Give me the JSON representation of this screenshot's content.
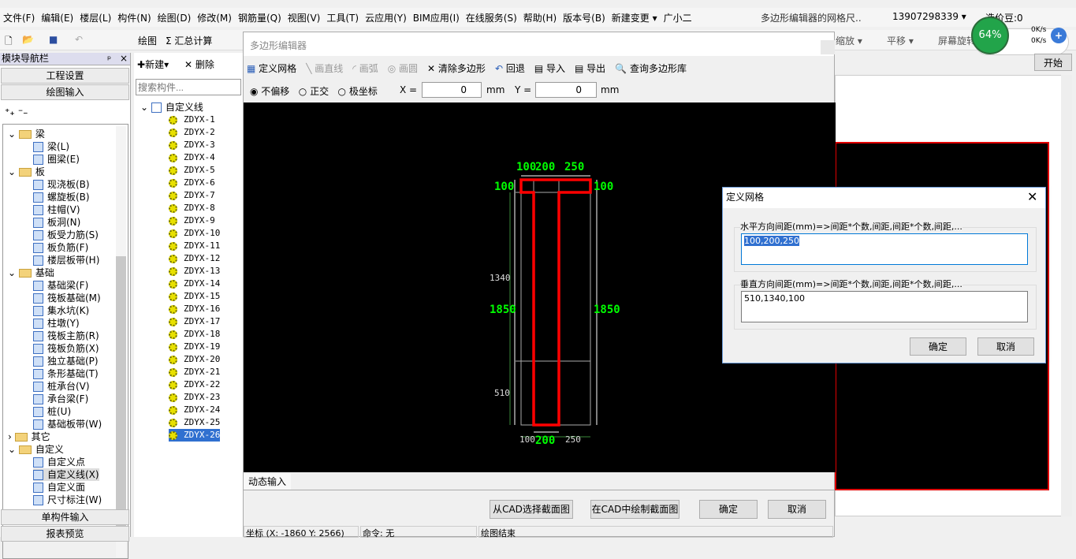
{
  "menu": [
    "文件(F)",
    "编辑(E)",
    "楼层(L)",
    "构件(N)",
    "绘图(D)",
    "修改(M)",
    "钢筋量(Q)",
    "视图(V)",
    "工具(T)",
    "云应用(Y)",
    "BIM应用(I)",
    "在线服务(S)",
    "帮助(H)",
    "版本号(B)",
    "新建变更 ▾",
    "广小二"
  ],
  "notice": "多边形编辑器的网格尺..",
  "account": "13907298339 ▾",
  "beans": "造价豆:0",
  "toolbar": {
    "draw": "绘图",
    "sum": "汇总计算",
    "zoom": "缩放 ▾",
    "pan": "平移 ▾",
    "rotate": "屏幕旋转"
  },
  "net_widget": {
    "percent": "64%",
    "up": "0K/s",
    "down": "0K/s",
    "start": "开始"
  },
  "nav": {
    "title": "模块导航栏",
    "pin": "ᵖ",
    "close": "x",
    "project_settings": "工程设置",
    "draw_input": "绘图输入",
    "single_input": "单构件输入",
    "report": "报表预览",
    "tree": [
      {
        "label": "梁",
        "level": 0,
        "type": "folder"
      },
      {
        "label": "梁(L)",
        "level": 1
      },
      {
        "label": "圈梁(E)",
        "level": 1
      },
      {
        "label": "板",
        "level": 0,
        "type": "folder"
      },
      {
        "label": "现浇板(B)",
        "level": 1
      },
      {
        "label": "螺旋板(B)",
        "level": 1
      },
      {
        "label": "柱帽(V)",
        "level": 1
      },
      {
        "label": "板洞(N)",
        "level": 1
      },
      {
        "label": "板受力筋(S)",
        "level": 1
      },
      {
        "label": "板负筋(F)",
        "level": 1
      },
      {
        "label": "楼层板带(H)",
        "level": 1
      },
      {
        "label": "基础",
        "level": 0,
        "type": "folder"
      },
      {
        "label": "基础梁(F)",
        "level": 1
      },
      {
        "label": "筏板基础(M)",
        "level": 1
      },
      {
        "label": "集水坑(K)",
        "level": 1
      },
      {
        "label": "柱墩(Y)",
        "level": 1
      },
      {
        "label": "筏板主筋(R)",
        "level": 1
      },
      {
        "label": "筏板负筋(X)",
        "level": 1
      },
      {
        "label": "独立基础(P)",
        "level": 1
      },
      {
        "label": "条形基础(T)",
        "level": 1
      },
      {
        "label": "桩承台(V)",
        "level": 1
      },
      {
        "label": "承台梁(F)",
        "level": 1
      },
      {
        "label": "桩(U)",
        "level": 1
      },
      {
        "label": "基础板带(W)",
        "level": 1
      },
      {
        "label": "其它",
        "level": 0,
        "type": "folder",
        "collapsed": true
      },
      {
        "label": "自定义",
        "level": 0,
        "type": "folder"
      },
      {
        "label": "自定义点",
        "level": 1
      },
      {
        "label": "自定义线(X)",
        "level": 1,
        "selected": true
      },
      {
        "label": "自定义面",
        "level": 1
      },
      {
        "label": "尺寸标注(W)",
        "level": 1
      }
    ]
  },
  "components": {
    "new": "新建",
    "delete": "删除",
    "search_placeholder": "搜索构件...",
    "root": "自定义线",
    "items": [
      "ZDYX-1",
      "ZDYX-2",
      "ZDYX-3",
      "ZDYX-4",
      "ZDYX-5",
      "ZDYX-6",
      "ZDYX-7",
      "ZDYX-8",
      "ZDYX-9",
      "ZDYX-10",
      "ZDYX-11",
      "ZDYX-12",
      "ZDYX-13",
      "ZDYX-14",
      "ZDYX-15",
      "ZDYX-16",
      "ZDYX-17",
      "ZDYX-18",
      "ZDYX-19",
      "ZDYX-20",
      "ZDYX-21",
      "ZDYX-22",
      "ZDYX-23",
      "ZDYX-24",
      "ZDYX-25",
      "ZDYX-26"
    ],
    "selected": "ZDYX-26"
  },
  "editor": {
    "title": "多边形编辑器",
    "tools": {
      "grid": "定义网格",
      "line": "画直线",
      "arc": "画弧",
      "circle": "画圆",
      "clear": "清除多边形",
      "undo": "回退",
      "import": "导入",
      "export": "导出",
      "query": "查询多边形库"
    },
    "modes": {
      "none": "不偏移",
      "ortho": "正交",
      "polar": "极坐标",
      "selected": "不偏移"
    },
    "x_label": "X =",
    "x_value": "0",
    "y_label": "Y =",
    "y_value": "0",
    "unit": "mm",
    "dims": {
      "top": [
        "100",
        "200",
        "250"
      ],
      "bottom": [
        "100",
        "200",
        "250"
      ],
      "left_total": "1850",
      "right_total": "1850",
      "left_top": "100",
      "left_top2": "100",
      "right_top": "100",
      "left_mid": "1340",
      "left_bot": "510"
    },
    "dynamic_tab": "动态输入",
    "btn_from_cad": "从CAD选择截面图",
    "btn_draw_cad": "在CAD中绘制截面图",
    "ok": "确定",
    "cancel": "取消",
    "status": {
      "coord": "坐标 (X: -1860 Y: 2566)",
      "command": "命令: 无",
      "state": "绘图结束"
    }
  },
  "grid_dialog": {
    "title": "定义网格",
    "h_label": "水平方向间距(mm)=>间距*个数,间距,间距*个数,间距,...",
    "h_value": "100,200,250",
    "v_label": "垂直方向间距(mm)=>间距*个数,间距,间距*个数,间距,...",
    "v_value": "510,1340,100",
    "ok": "确定",
    "cancel": "取消"
  },
  "colors": {
    "outline": "#ff0000",
    "dim_text": "#00ff00",
    "selection": "#3070d0"
  }
}
